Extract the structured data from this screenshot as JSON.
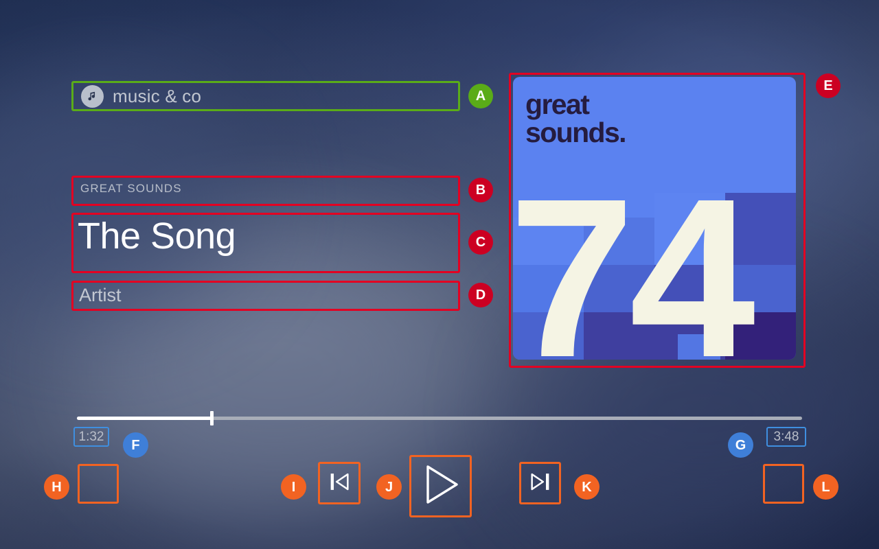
{
  "app": {
    "icon": "music-note-icon",
    "name": "music & co"
  },
  "now_playing": {
    "album_label": "GREAT SOUNDS",
    "title": "The Song",
    "artist": "Artist"
  },
  "album_art": {
    "brand_line1": "great",
    "brand_line2": "sounds.",
    "number": "74",
    "bg_color": "#5b82f0",
    "text_color": "#251c3f",
    "number_color": "#f5f4e4"
  },
  "progress": {
    "elapsed": "1:32",
    "total": "3:48",
    "percent": 18.6,
    "fill_color": "#ffffff",
    "track_color": "#a8adb8"
  },
  "controls": {
    "shuffle": {
      "name": "shuffle-button",
      "icon": "blank-icon"
    },
    "previous": {
      "name": "previous-track-button",
      "icon": "skip-previous-icon"
    },
    "play": {
      "name": "play-button",
      "icon": "play-icon"
    },
    "next": {
      "name": "next-track-button",
      "icon": "skip-next-icon"
    },
    "repeat": {
      "name": "repeat-button",
      "icon": "blank-icon"
    }
  },
  "annotations": {
    "colors": {
      "red": "#e30022",
      "red_badge": "#cc0022",
      "green": "#5aac18",
      "orange": "#f26322",
      "blue": "#3f7fd8",
      "blue_outline": "#3f8fe0"
    },
    "markers": [
      {
        "id": "A",
        "label": "A",
        "target": "app-name-chip",
        "color": "green"
      },
      {
        "id": "B",
        "label": "B",
        "target": "album-label",
        "color": "red"
      },
      {
        "id": "C",
        "label": "C",
        "target": "track-title",
        "color": "red"
      },
      {
        "id": "D",
        "label": "D",
        "target": "artist-name",
        "color": "red"
      },
      {
        "id": "E",
        "label": "E",
        "target": "album-art",
        "color": "red"
      },
      {
        "id": "F",
        "label": "F",
        "target": "time-elapsed",
        "color": "blue"
      },
      {
        "id": "G",
        "label": "G",
        "target": "time-total",
        "color": "blue"
      },
      {
        "id": "H",
        "label": "H",
        "target": "shuffle-button",
        "color": "orange"
      },
      {
        "id": "I",
        "label": "I",
        "target": "previous-track-button",
        "color": "orange"
      },
      {
        "id": "J",
        "label": "J",
        "target": "play-button",
        "color": "orange"
      },
      {
        "id": "K",
        "label": "K",
        "target": "next-track-button",
        "color": "orange"
      },
      {
        "id": "L",
        "label": "L",
        "target": "repeat-button",
        "color": "orange"
      }
    ]
  },
  "background": {
    "base_color": "#1e2c4f",
    "highlight_color": "#848fa6"
  }
}
